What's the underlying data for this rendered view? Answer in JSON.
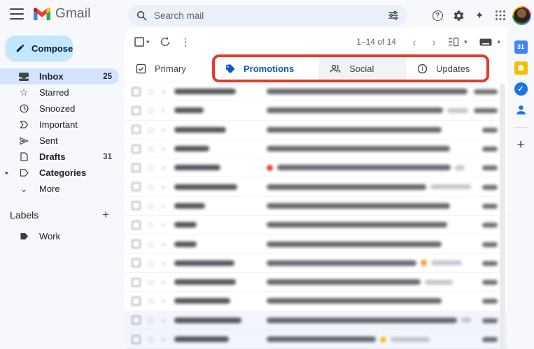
{
  "header": {
    "logo_text": "Gmail",
    "search_placeholder": "Search mail"
  },
  "icons": {
    "star": "☆",
    "important": "»",
    "more_vert": "⋮",
    "caret": "▾",
    "chev_left": "‹",
    "chev_right": "›",
    "help": "?",
    "sparkle": "✦",
    "plus": "+",
    "expander": "▸",
    "chevron_down": "⌄",
    "check": "✓",
    "calendar_day": "31"
  },
  "sidebar": {
    "compose_label": "Compose",
    "items": [
      {
        "label": "Inbox",
        "count": "25"
      },
      {
        "label": "Starred",
        "count": ""
      },
      {
        "label": "Snoozed",
        "count": ""
      },
      {
        "label": "Important",
        "count": ""
      },
      {
        "label": "Sent",
        "count": ""
      },
      {
        "label": "Drafts",
        "count": "31"
      },
      {
        "label": "Categories",
        "count": ""
      },
      {
        "label": "More",
        "count": ""
      }
    ],
    "labels_header": "Labels",
    "labels": [
      {
        "label": "Work"
      }
    ]
  },
  "toolbar": {
    "pagination": "1–14 of 14"
  },
  "tabs": [
    {
      "label": "Primary",
      "active": false
    },
    {
      "label": "Promotions",
      "active": true
    },
    {
      "label": "Social",
      "active": false
    },
    {
      "label": "Updates",
      "active": false
    }
  ],
  "annotation": {
    "color": "#e33b2e",
    "target": "promotions-social-updates-tabs"
  },
  "email_rows": [
    {
      "read": false,
      "sender_w": 88,
      "subject_w": 287,
      "tail_w": 0,
      "emoji": null,
      "emoji_pos": null,
      "date_w": 34
    },
    {
      "read": false,
      "sender_w": 42,
      "subject_w": 252,
      "tail_w": 30,
      "emoji": null,
      "emoji_pos": null,
      "date_w": 34
    },
    {
      "read": false,
      "sender_w": 74,
      "subject_w": 250,
      "tail_w": 0,
      "emoji": null,
      "emoji_pos": null,
      "date_w": 22
    },
    {
      "read": false,
      "sender_w": 50,
      "subject_w": 262,
      "tail_w": 0,
      "emoji": null,
      "emoji_pos": null,
      "date_w": 22
    },
    {
      "read": false,
      "sender_w": 66,
      "subject_w": 248,
      "tail_w": 14,
      "emoji": "#e8453c",
      "emoji_pos": "start",
      "date_w": 22
    },
    {
      "read": false,
      "sender_w": 90,
      "subject_w": 228,
      "tail_w": 58,
      "emoji": null,
      "emoji_pos": null,
      "date_w": 22
    },
    {
      "read": false,
      "sender_w": 44,
      "subject_w": 262,
      "tail_w": 0,
      "emoji": null,
      "emoji_pos": null,
      "date_w": 22
    },
    {
      "read": false,
      "sender_w": 32,
      "subject_w": 258,
      "tail_w": 0,
      "emoji": null,
      "emoji_pos": null,
      "date_w": 22
    },
    {
      "read": false,
      "sender_w": 32,
      "subject_w": 250,
      "tail_w": 0,
      "emoji": null,
      "emoji_pos": null,
      "date_w": 22
    },
    {
      "read": false,
      "sender_w": 86,
      "subject_w": 214,
      "tail_w": 44,
      "emoji": "#f2a43a",
      "emoji_pos": "mid",
      "date_w": 22
    },
    {
      "read": false,
      "sender_w": 88,
      "subject_w": 220,
      "tail_w": 40,
      "emoji": null,
      "emoji_pos": null,
      "date_w": 22
    },
    {
      "read": false,
      "sender_w": 80,
      "subject_w": 250,
      "tail_w": 0,
      "emoji": null,
      "emoji_pos": null,
      "date_w": 22
    },
    {
      "read": true,
      "sender_w": 96,
      "subject_w": 272,
      "tail_w": 14,
      "emoji": null,
      "emoji_pos": null,
      "date_w": 22
    },
    {
      "read": true,
      "sender_w": 78,
      "subject_w": 156,
      "tail_w": 56,
      "emoji": "#f7c331",
      "emoji_pos": "mid",
      "date_w": 22
    }
  ],
  "colors": {
    "canvas": "#f6f8fc",
    "accent_blue": "#0b57d0",
    "compose_bg": "#c2e7ff",
    "selected_bg": "#d3e3fd",
    "read_row_bg": "#f2f6fc",
    "annotation_red": "#e33b2e"
  }
}
